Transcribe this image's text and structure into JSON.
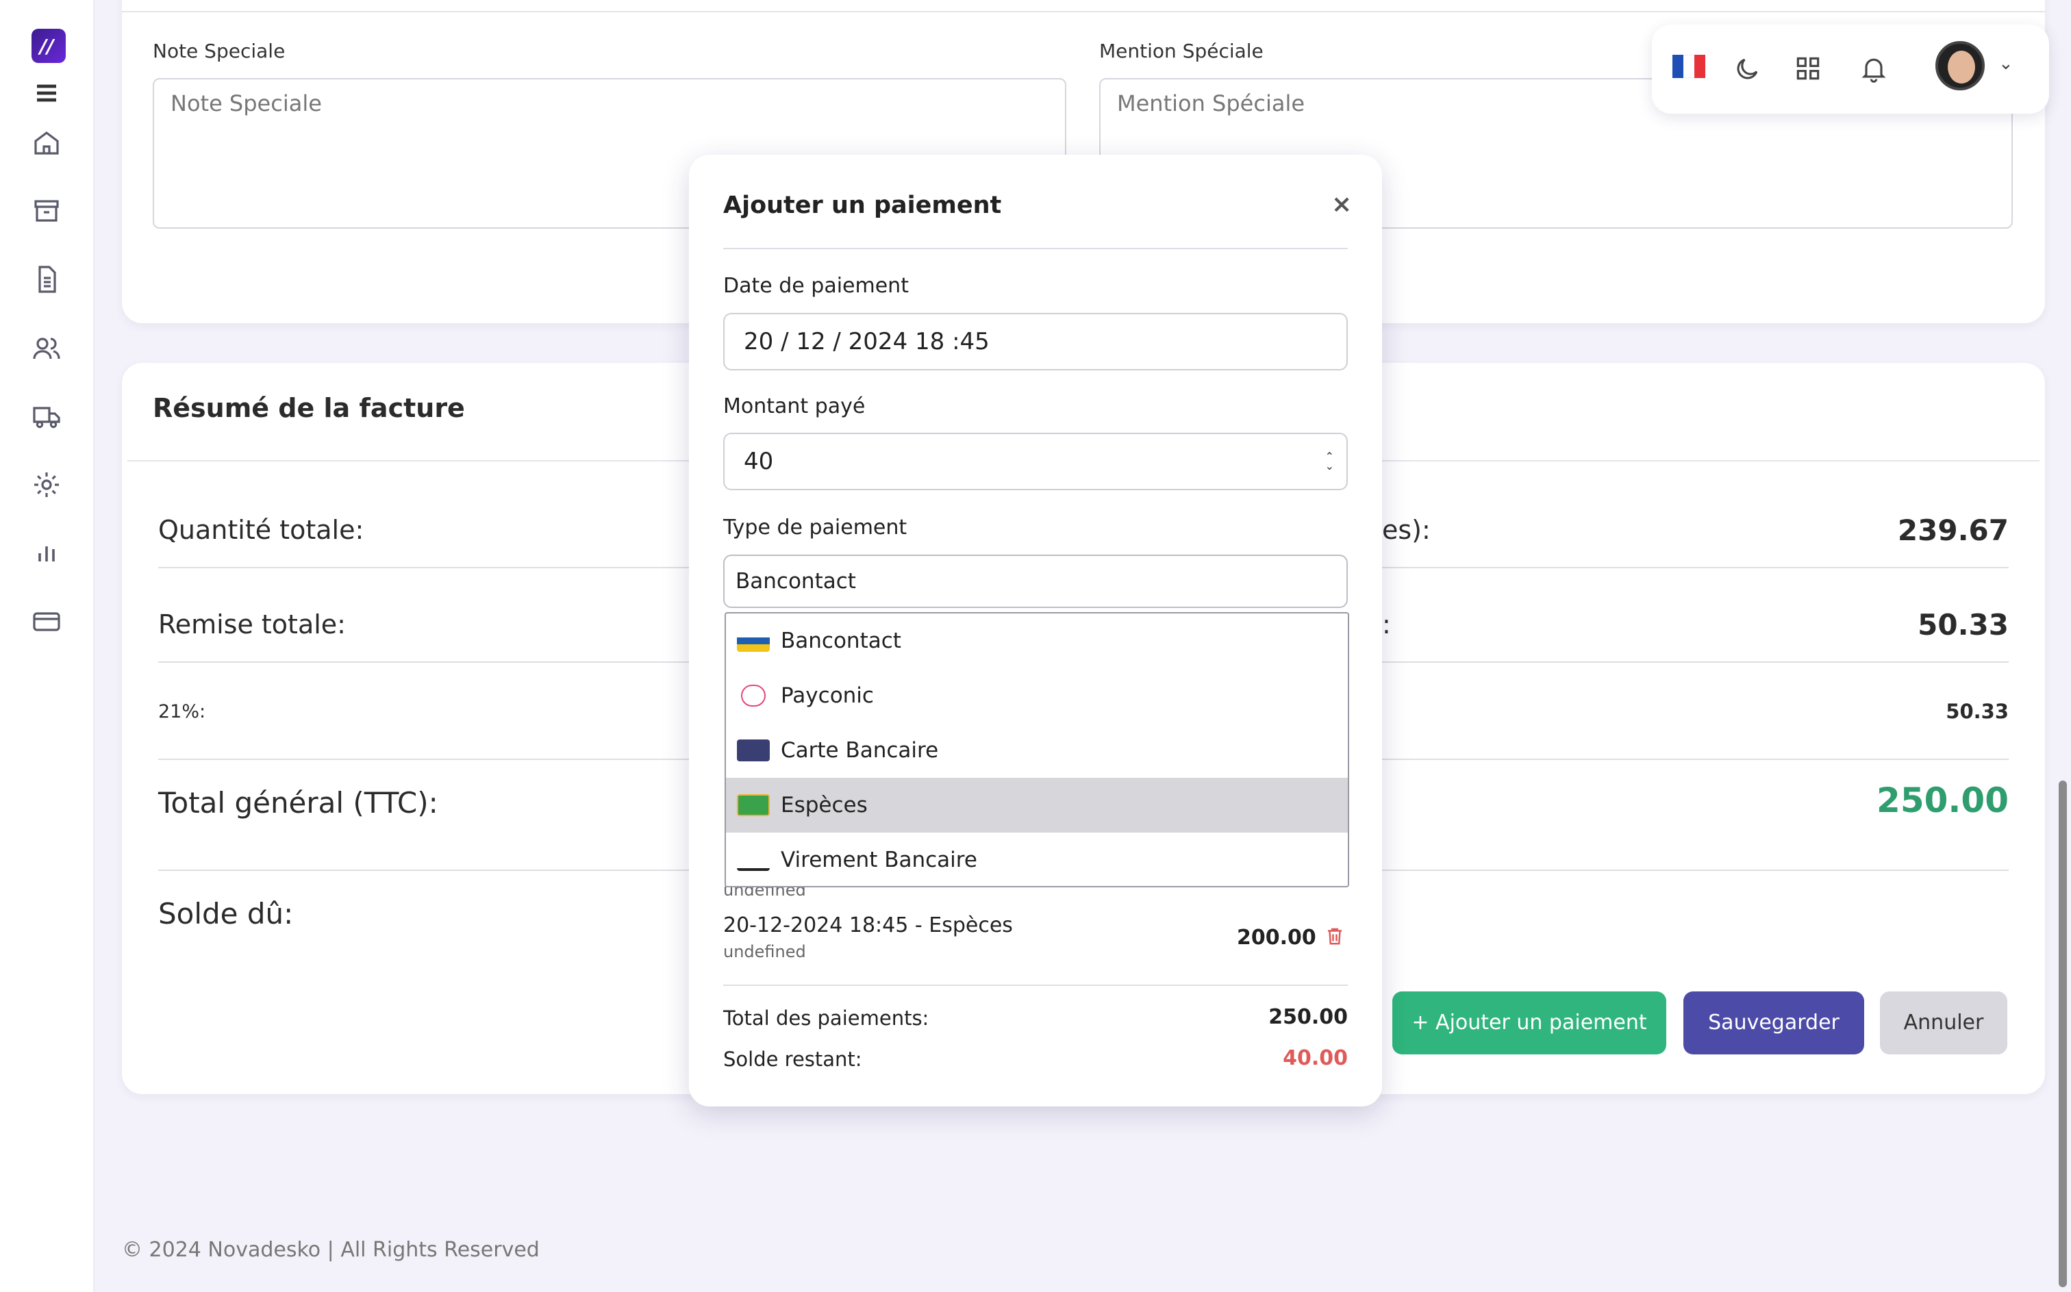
{
  "sidebar": {
    "logo_text": "//",
    "icons": [
      "menu-icon",
      "home-icon",
      "archive-icon",
      "document-icon",
      "users-icon",
      "truck-icon",
      "gear-icon",
      "chart-icon",
      "card-icon"
    ]
  },
  "notes": {
    "note_label": "Note Speciale",
    "note_placeholder": "Note Speciale",
    "mention_label": "Mention Spéciale",
    "mention_placeholder": "Mention Spéciale"
  },
  "summary": {
    "title": "Résumé de la facture",
    "rows": [
      {
        "label": "Quantité totale:",
        "right_label": "es):",
        "value": "239.67"
      },
      {
        "label": "Remise totale:",
        "right_label": ":",
        "value": "50.33"
      },
      {
        "label": "21%:",
        "value": "50.33"
      },
      {
        "label": "Total général (TTC):",
        "value": "250.00"
      },
      {
        "label": "Solde dû:"
      }
    ]
  },
  "actions": {
    "add_payment": "+ Ajouter un paiement",
    "save": "Sauvegarder",
    "cancel": "Annuler"
  },
  "footer": "© 2024 Novadesko | All Rights Reserved",
  "topbar": {
    "flag_colors": [
      "#1f4fb5",
      "#ffffff",
      "#e8323a"
    ],
    "icons": [
      "moon-icon",
      "grid-icon",
      "bell-icon"
    ]
  },
  "modal": {
    "title": "Ajouter un paiement",
    "close": "×",
    "date_label": "Date de paiement",
    "date_value": "20 / 12 / 2024  18 :45",
    "amount_label": "Montant payé",
    "amount_value": "40",
    "type_label": "Type de paiement",
    "type_value": "Bancontact",
    "options": [
      "Bancontact",
      "Payconic",
      "Carte Bancaire",
      "Espèces",
      "Virement Bancaire"
    ],
    "selected_option": "Espèces",
    "payments": [
      {
        "line": "",
        "sub": "undefined"
      },
      {
        "line": "20-12-2024 18:45 - Espèces",
        "sub": "undefined",
        "amount": "200.00"
      }
    ],
    "total_label": "Total des paiements:",
    "total_value": "250.00",
    "remaining_label": "Solde restant:",
    "remaining_value": "40.00"
  },
  "colors": {
    "accent_green": "#2fb57d",
    "accent_indigo": "#4c4ba8",
    "total_green": "#2f9d6e",
    "danger_red": "#e05a5a"
  }
}
